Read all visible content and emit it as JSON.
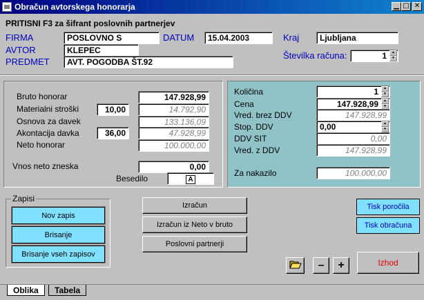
{
  "window": {
    "title": "Obračun avtorskega honorarja",
    "controls": {
      "minimize": "▁",
      "maximize": "□",
      "close": "✕"
    }
  },
  "hint": "PRITISNI F3 za šifrant poslovnih partnerjev",
  "header": {
    "firma_label": "FIRMA",
    "firma_value": "POSLOVNO S",
    "avtor_label": "AVTOR",
    "avtor_value": "KLEPEC",
    "predmet_label": "PREDMET",
    "predmet_value": "AVT. POGODBA ŠT.92",
    "datum_label": "DATUM",
    "datum_value": "15.04.2003",
    "kraj_label": "Kraj",
    "kraj_value": "Ljubljana",
    "racun_label": "Številka računa:",
    "racun_value": "1"
  },
  "calc": {
    "bruto_label": "Bruto honorar",
    "bruto_value": "147.928,99",
    "mat_label": "Materialni stroški",
    "mat_pct": "10,00",
    "mat_value": "14.792,90",
    "osnova_label": "Osnova za davek",
    "osnova_value": "133.136,09",
    "akont_label": "Akontacija davka",
    "akont_pct": "36,00",
    "akont_value": "47.928,99",
    "neto_label": "Neto honorar",
    "neto_value": "100.000,00",
    "vnos_label": "Vnos neto zneska",
    "vnos_value": "0,00",
    "besedilo_label": "Besedilo",
    "besedilo_glyph": "A"
  },
  "invoice": {
    "kolicina_label": "Količina",
    "kolicina_value": "1",
    "cena_label": "Cena",
    "cena_value": "147.928,99",
    "brez_label": "Vred. brez DDV",
    "brez_value": "147.928,99",
    "stop_label": "Stop. DDV",
    "stop_value": "0,00",
    "sit_label": "DDV SIT",
    "sit_value": "0,00",
    "zddv_label": "Vred. z DDV",
    "zddv_value": "147.928,99",
    "nakazilo_label": "Za nakazilo",
    "nakazilo_value": "100.000,00"
  },
  "zapisi": {
    "title": "Zapisi",
    "nov": "Nov zapis",
    "brisanje": "Brisanje",
    "brisanje_vseh": "Brisanje vseh zapisov"
  },
  "actions": {
    "izracun": "Izračun",
    "izracun_neto": "Izračun iz  Neto v bruto",
    "partnerji": "Poslovni partnerji",
    "tisk_porocila": "Tisk poročila",
    "tisk_obracuna": "Tisk obračuna",
    "izhod": "Izhod",
    "minus": "–",
    "plus": "+"
  },
  "tabs": [
    {
      "label": "Oblika"
    },
    {
      "label": "Tabela"
    }
  ],
  "icons": {
    "folder": "folder-open-icon"
  }
}
